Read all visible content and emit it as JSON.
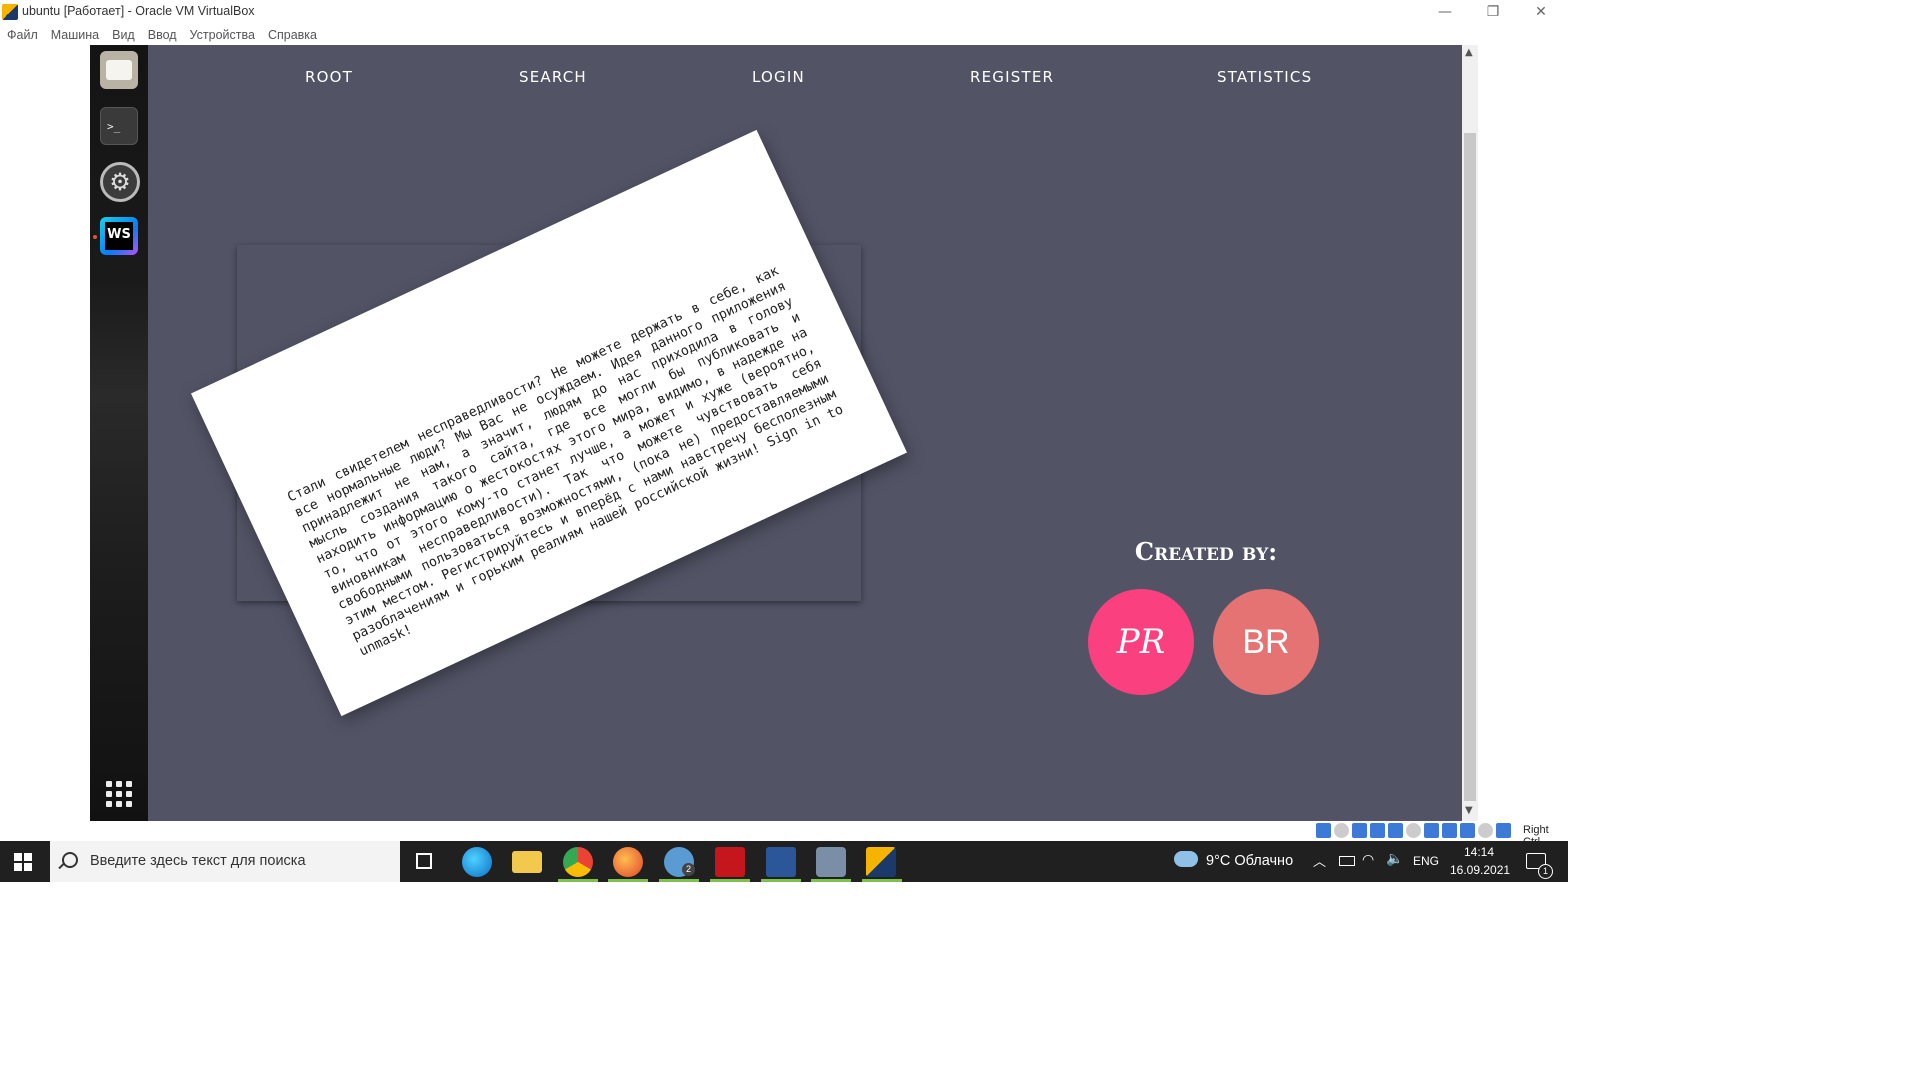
{
  "window": {
    "title": "ubuntu [Работает] - Oracle VM VirtualBox",
    "controls": {
      "minimize": "—",
      "maximize": "❐",
      "close": "✕"
    }
  },
  "menu": [
    "Файл",
    "Машина",
    "Вид",
    "Ввод",
    "Устройства",
    "Справка"
  ],
  "dock": {
    "terminal_prompt": ">_",
    "webstorm_label": "WS"
  },
  "site": {
    "nav": [
      "ROOT",
      "SEARCH",
      "LOGIN",
      "REGISTER",
      "STATISTICS"
    ],
    "card_text": "Стали свидетелем несправедливости? Не можете держать в себе, как все нормальные люди? Мы Вас не осуждаем. Идея данного приложения принадлежит не нам, а значит, людям до нас приходила в голову мысль создания такого сайта, где все могли бы публиковать и находить информацию о жестокостях этого мира, видимо, в надежде на то, что от этого кому-то станет лучше, а может и хуже (вероятно, виновникам несправедливости). Так что можете чувствовать себя свободными пользоваться возможностями, (пока не) предоставляемыми этим местом. Регистрируйтесь и вперёд с нами навстречу бесполезным разоблачениям и горьким реалиям нашей российской жизни! Sign in to unmask!",
    "created_by": "Created by:",
    "authors": [
      "PR",
      "BR"
    ]
  },
  "statusbar": {
    "host_key": "Right Ctrl"
  },
  "taskbar": {
    "search_placeholder": "Введите здесь текст для поиска",
    "weather": "9°C  Облачно",
    "language": "ENG",
    "time": "14:14",
    "date": "16.09.2021",
    "notifications": "1",
    "telegram_badge": "2"
  },
  "colors": {
    "site_background": "#525466",
    "avatar_pr": "#fb407f",
    "avatar_br": "#e57373"
  }
}
